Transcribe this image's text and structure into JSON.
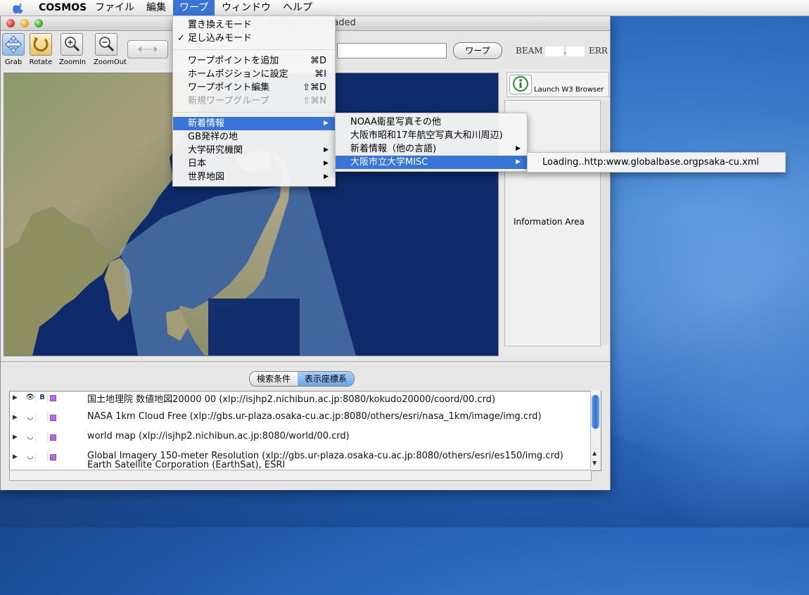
{
  "menubar": {
    "app": "COSMOS",
    "items": [
      "ファイル",
      "編集",
      "ワープ",
      "ウィンドウ",
      "ヘルプ"
    ]
  },
  "window": {
    "title": "AVHRR satellite 1km shaded"
  },
  "toolbar": {
    "grab": "Grab",
    "rotate": "Rotate",
    "zoomin": "ZoomIn",
    "zoomout": "ZoomOut",
    "warp_button": "ワープ",
    "beam_label": "BEAM",
    "beam_dot": ".",
    "err_label": "ERR"
  },
  "right_panel": {
    "launch_label": "Launch W3 Browser",
    "info_label": "Information Area"
  },
  "warp_menu": {
    "items": [
      {
        "label": "置き換えモード",
        "check": "",
        "shortcut": "",
        "disabled": false
      },
      {
        "label": "足し込みモード",
        "check": "✓",
        "shortcut": "",
        "disabled": false
      },
      {
        "label": "ワープポイントを追加",
        "check": "",
        "shortcut": "⌘D",
        "disabled": false
      },
      {
        "label": "ホームポジションに設定",
        "check": "",
        "shortcut": "⌘I",
        "disabled": false
      },
      {
        "label": "ワープポイント編集",
        "check": "",
        "shortcut": "⇧⌘D",
        "disabled": false
      },
      {
        "label": "新規ワープグループ",
        "check": "",
        "shortcut": "⇧⌘N",
        "disabled": true
      },
      {
        "label": "新着情報"
      },
      {
        "label": "GB発祥の地"
      },
      {
        "label": "大学研究機関"
      },
      {
        "label": "日本"
      },
      {
        "label": "世界地図"
      }
    ]
  },
  "submenu1": {
    "items": [
      {
        "label": "NOAA衛星写真その他"
      },
      {
        "label": "大阪市昭和17年航空写真大和川周辺)"
      },
      {
        "label": "新着情報（他の言語)"
      },
      {
        "label": "大阪市立大学MISC"
      }
    ]
  },
  "submenu2": {
    "items": [
      {
        "label": "Loading..http:www.globalbase.orgpsaka-cu.xml"
      }
    ]
  },
  "bottom": {
    "tabs": [
      "検索条件",
      "表示座標系"
    ],
    "rows": [
      {
        "icon": "👁",
        "b": "B",
        "text": "国土地理院 数値地図20000 00 (xlp://isjhp2.nichibun.ac.jp:8080/kokudo20000/coord/00.crd)",
        "text2": ""
      },
      {
        "icon": "◡",
        "b": "",
        "text": "NASA 1km Cloud Free (xlp://gbs.ur-plaza.osaka-cu.ac.jp:8080/others/esri/nasa_1km/image/img.crd)",
        "text2": ""
      },
      {
        "icon": "◡",
        "b": "",
        "text": "world map (xlp://isjhp2.nichibun.ac.jp:8080/world/00.crd)",
        "text2": ""
      },
      {
        "icon": "◡",
        "b": "",
        "text": "Global Imagery 150-meter Resolution (xlp://gbs.ur-plaza.osaka-cu.ac.jp:8080/others/esri/es150/img.crd)",
        "text2": "Earth Satellite Corporation (EarthSat), ESRI"
      }
    ]
  },
  "colors": {
    "accent": "#3875d7",
    "ocean": "#0e2a6a"
  }
}
